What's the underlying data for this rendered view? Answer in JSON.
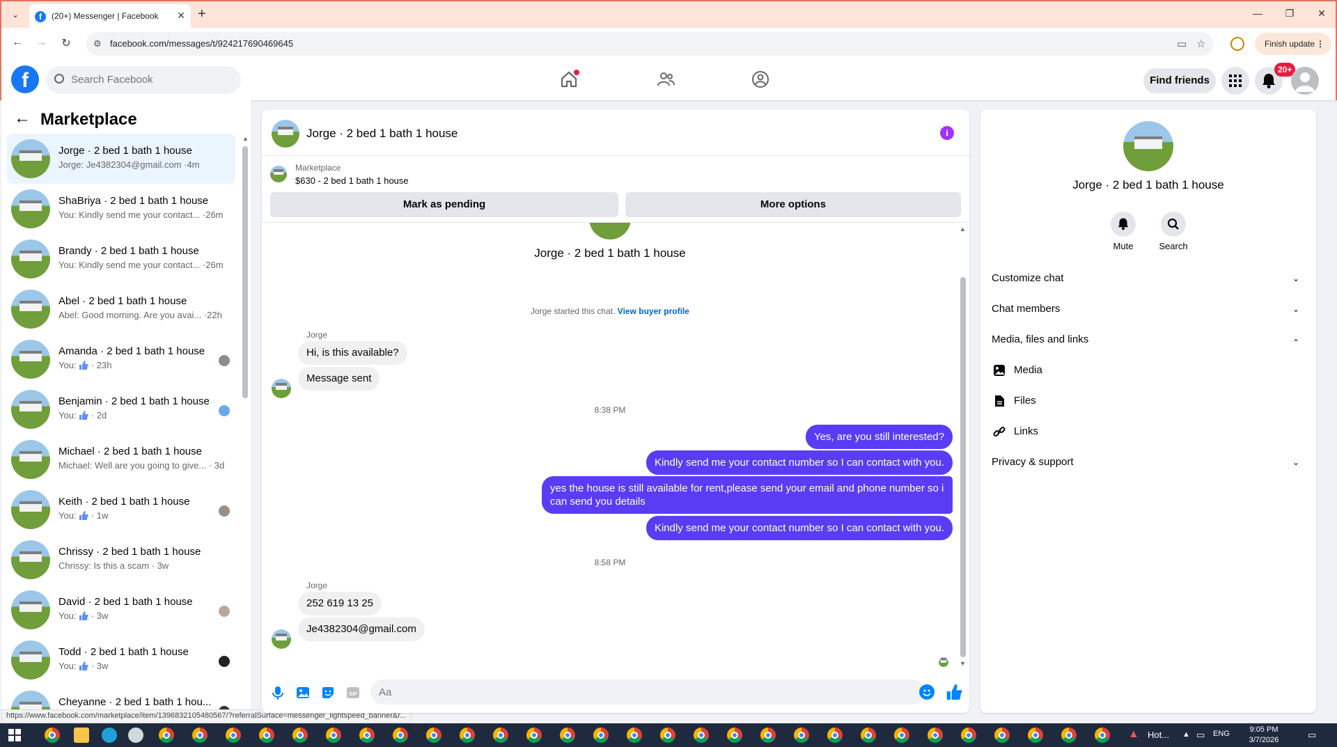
{
  "browser": {
    "tab_title": "(20+) Messenger | Facebook",
    "url": "facebook.com/messages/t/924217690469645",
    "finish_update_label": "Finish update",
    "status_url": "https://www.facebook.com/marketplace/item/1396832105480567/?referralSurface=messenger_lightspeed_banner&r..."
  },
  "fb_header": {
    "search_placeholder": "Search Facebook",
    "find_friends_label": "Find friends",
    "notifications_badge": "20+"
  },
  "left_panel": {
    "title": "Marketplace",
    "conversations": [
      {
        "name": "Jorge · 2 bed 1 bath 1 house",
        "preview": "Jorge: Je4382304@gmail.com ·4m"
      },
      {
        "name": "ShaBriya · 2 bed 1 bath 1 house",
        "preview": "You: Kindly send me your contact... ·26m"
      },
      {
        "name": "Brandy · 2 bed 1 bath 1 house",
        "preview": "You: Kindly send me your contact... ·26m"
      },
      {
        "name": "Abel · 2 bed 1 bath 1 house",
        "preview": "Abel: Good morning. Are you avai... ·22h"
      },
      {
        "name": "Amanda · 2 bed 1 bath 1 house",
        "preview_prefix": "You:",
        "preview_suffix": "· 23h"
      },
      {
        "name": "Benjamin · 2 bed 1 bath 1 house",
        "preview_prefix": "You:",
        "preview_suffix": "· 2d"
      },
      {
        "name": "Michael · 2 bed 1 bath 1 house",
        "preview": "Michael: Well are you going to give... · 3d"
      },
      {
        "name": "Keith · 2 bed 1 bath 1 house",
        "preview_prefix": "You:",
        "preview_suffix": "· 1w"
      },
      {
        "name": "Chrissy · 2 bed 1 bath 1 house",
        "preview": "Chrissy: Is this a scam · 3w"
      },
      {
        "name": "David · 2 bed 1 bath 1 house",
        "preview_prefix": "You:",
        "preview_suffix": "· 3w"
      },
      {
        "name": "Todd · 2 bed 1 bath 1 house",
        "preview_prefix": "You:",
        "preview_suffix": "· 3w"
      },
      {
        "name": "Cheyanne · 2 bed 1 bath 1 hou..."
      }
    ]
  },
  "chat": {
    "header_title": "Jorge · 2 bed 1 bath 1 house",
    "marketplace_label": "Marketplace",
    "listing": "$630 - 2 bed 1 bath 1 house",
    "mark_pending_label": "Mark as pending",
    "more_options_label": "More options",
    "center_title": "Jorge · 2 bed 1 bath 1 house",
    "started_text": "Jorge started this chat.",
    "view_profile_label": "View buyer profile",
    "sender_name_1": "Jorge",
    "incoming_1": [
      "Hi, is this available?",
      "Message sent"
    ],
    "time_1": "8:38 PM",
    "outgoing": [
      "Yes, are you still interested?",
      "Kindly send me your contact number so I can contact with you.",
      "yes the house is still available for rent,please send your email and phone number so i can send you details",
      "Kindly send me your contact number so I can contact with you."
    ],
    "time_2": "8:58 PM",
    "sender_name_2": "Jorge",
    "incoming_2": [
      "252 619 13 25",
      "Je4382304@gmail.com"
    ],
    "composer_placeholder": "Aa"
  },
  "right_panel": {
    "name": "Jorge · 2 bed 1 bath 1 house",
    "mute_label": "Mute",
    "search_label": "Search",
    "sections": [
      "Customize chat",
      "Chat members",
      "Media, files and links"
    ],
    "media_items": [
      "Media",
      "Files",
      "Links"
    ],
    "privacy_label": "Privacy & support"
  },
  "taskbar": {
    "weather_text": "Hot...",
    "lang": "ENG",
    "time": "9:05 PM",
    "date": "3/7/2026"
  },
  "colors": {
    "fb_blue": "#1877f2",
    "outgoing_bubble": "#5b3cf5",
    "notification_red": "#e41e3f",
    "info_purple": "#a033ff"
  }
}
